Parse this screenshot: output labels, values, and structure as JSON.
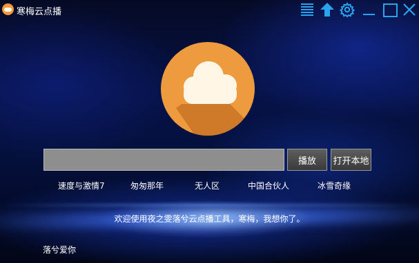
{
  "window": {
    "title": "寒梅云点播"
  },
  "toolbar": {
    "icons": [
      "menu-icon",
      "upload-icon",
      "gear-icon",
      "minimize-icon",
      "maximize-icon",
      "close-icon"
    ],
    "accent_color": "#2aa4ef"
  },
  "logo": {
    "icon": "cloud-icon",
    "circle_color": "#ee9a3f",
    "cloud_color": "#fff6e6"
  },
  "search": {
    "value": "",
    "placeholder": ""
  },
  "buttons": {
    "play": "播放",
    "open_local": "打开本地"
  },
  "suggestions": [
    "速度与激情7",
    "匆匆那年",
    "无人区",
    "中国合伙人",
    "冰雪奇缘"
  ],
  "welcome_text": "欢迎使用夜之雯落兮云点播工具，寒梅，我想你了。",
  "footer_text": "落兮爱你"
}
